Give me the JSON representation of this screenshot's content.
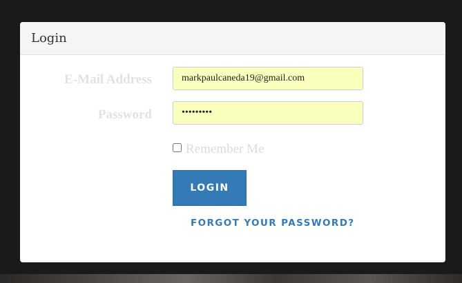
{
  "panel": {
    "title": "Login"
  },
  "form": {
    "email_label": "E-Mail Address",
    "email_value": "markpaulcaneda19@gmail.com",
    "password_label": "Password",
    "password_value": "mpcaneda1",
    "remember_label": "Remember Me",
    "remember_checked": false,
    "login_button": "LOGIN",
    "forgot_link": "FORGOT YOUR PASSWORD?"
  },
  "colors": {
    "accent": "#337ab7",
    "autofill_background": "#fbffbd",
    "page_background": "#1a1a1a"
  }
}
